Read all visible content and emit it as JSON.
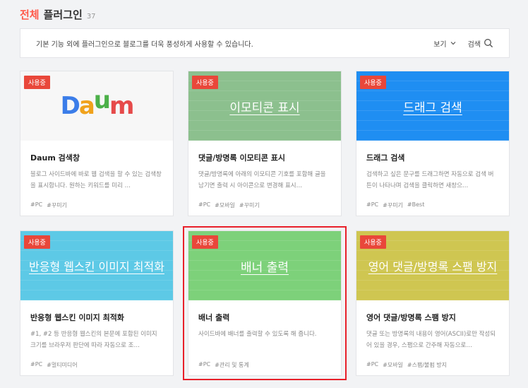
{
  "header": {
    "accent": "전체",
    "title": "플러그인",
    "count": "37"
  },
  "desc_bar": {
    "text": "기본 기능 외에 플러그인으로 블로그를 더욱 풍성하게 사용할 수 있습니다.",
    "view_label": "보기",
    "search_label": "검색"
  },
  "badge": "사용중",
  "cards": [
    {
      "thumb_text": "Daum",
      "name": "Daum 검색창",
      "text": "블로그 사이드바에 바로 웹 검색을 할 수 있는 검색창을 표시합니다. 원하는 키워드를 미리 …",
      "tags": [
        "#PC",
        "#꾸미기"
      ]
    },
    {
      "thumb_text": "이모티콘 표시",
      "name": "댓글/방명록 이모티콘 표시",
      "text": "댓글/방명록에 아래의 이모티콘 기호를 포함해 글을 남기면 출력 시 아이콘으로 변경해 표시…",
      "tags": [
        "#PC",
        "#모바일",
        "#꾸미기"
      ]
    },
    {
      "thumb_text": "드래그 검색",
      "name": "드래그 검색",
      "text": "검색하고 싶은 문구를 드래그하면 자동으로 검색 버튼이 나타나며 검색을 클릭하면 새창으…",
      "tags": [
        "#PC",
        "#꾸미기",
        "#Best"
      ]
    },
    {
      "thumb_text": "반응형 웹스킨 이미지 최적화",
      "name": "반응형 웹스킨 이미지 최적화",
      "text": "#1, #2 등 반응형 웹스킨의 본문에 포함된 이미지 크기를 브라우저 판단에 따라 자동으로 조…",
      "tags": [
        "#PC",
        "#멀티미디어"
      ]
    },
    {
      "thumb_text": "배너 출력",
      "name": "배너 출력",
      "text": "사이드바에 배너를 출력할 수 있도록 해 줍니다.",
      "tags": [
        "#PC",
        "#관리 및 통계"
      ]
    },
    {
      "thumb_text": "영어 댓글/방명록 스팸 방지",
      "name": "영어 댓글/방명록 스팸 방지",
      "text": "댓글 또는 방명록의 내용이 영어(ASCII)로만 작성되어 있을 경우, 스팸으로 간주해 자동으로…",
      "tags": [
        "#PC",
        "#모바일",
        "#스팸/불펌 방지"
      ]
    }
  ],
  "colors": {
    "accent": "#ff5a4a",
    "badge": "#e9473a",
    "emoticon": "#8cc08e",
    "drag": "#1f8ef2",
    "responsive": "#5dc9e6",
    "banner": "#7dd17a",
    "spam": "#cfc651",
    "selection": "#e8202a"
  }
}
